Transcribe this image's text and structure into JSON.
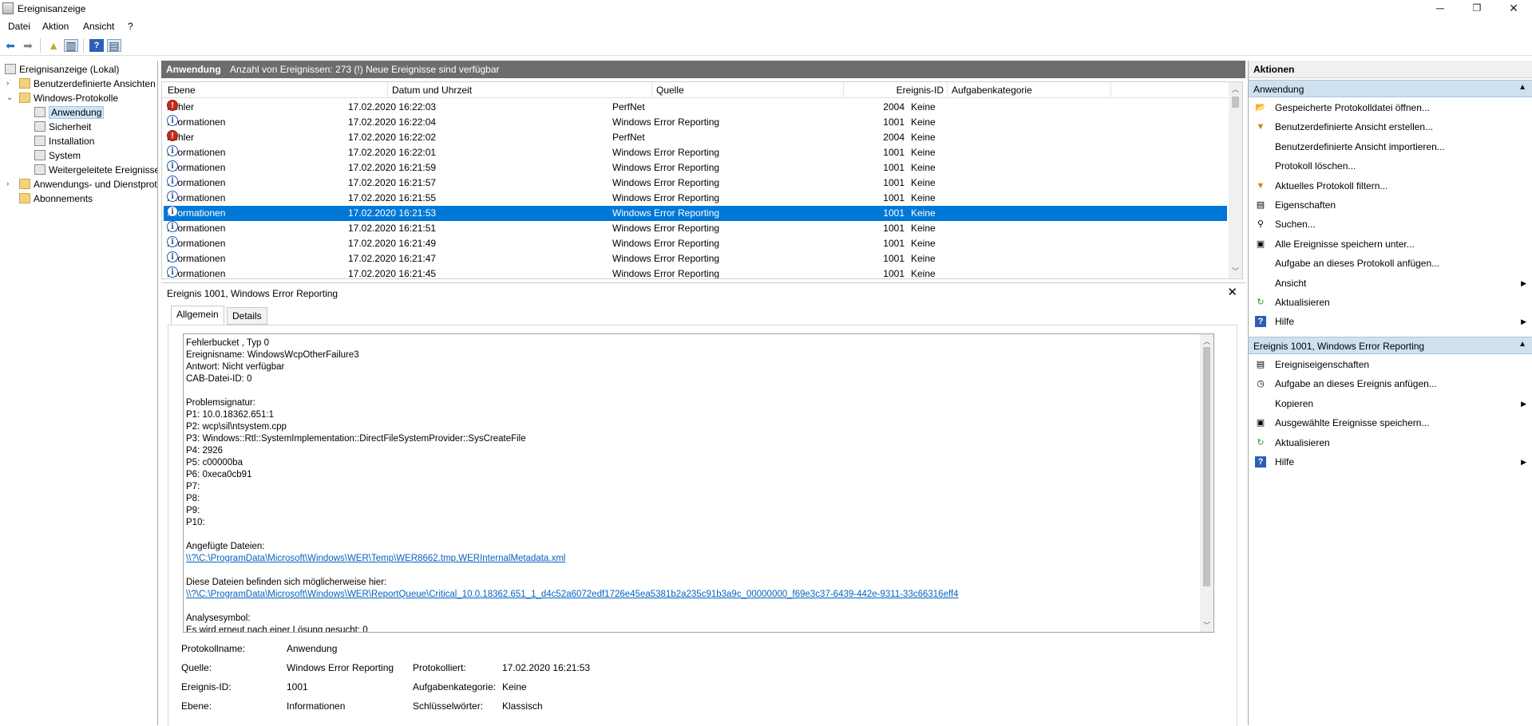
{
  "window": {
    "title": "Ereignisanzeige",
    "min": "─",
    "max": "❐",
    "close": "✕"
  },
  "menu": [
    "Datei",
    "Aktion",
    "Ansicht",
    "?"
  ],
  "tree": {
    "root": "Ereignisanzeige (Lokal)",
    "custom_views": "Benutzerdefinierte Ansichten",
    "windows_logs": "Windows-Protokolle",
    "logs": [
      "Anwendung",
      "Sicherheit",
      "Installation",
      "System",
      "Weitergeleitete Ereignisse"
    ],
    "app_services": "Anwendungs- und Dienstprotokolle",
    "subscriptions": "Abonnements"
  },
  "center": {
    "header_title": "Anwendung",
    "header_count": "Anzahl von Ereignissen: 273 (!) Neue Ereignisse sind verfügbar",
    "columns": [
      "Ebene",
      "Datum und Uhrzeit",
      "Quelle",
      "Ereignis-ID",
      "Aufgabenkategorie"
    ],
    "rows": [
      {
        "level": "Fehler",
        "icon": "error",
        "date": "17.02.2020 16:22:03",
        "source": "PerfNet",
        "id": "2004",
        "cat": "Keine"
      },
      {
        "level": "Informationen",
        "icon": "info",
        "date": "17.02.2020 16:22:04",
        "source": "Windows Error Reporting",
        "id": "1001",
        "cat": "Keine"
      },
      {
        "level": "Fehler",
        "icon": "error",
        "date": "17.02.2020 16:22:02",
        "source": "PerfNet",
        "id": "2004",
        "cat": "Keine"
      },
      {
        "level": "Informationen",
        "icon": "info",
        "date": "17.02.2020 16:22:01",
        "source": "Windows Error Reporting",
        "id": "1001",
        "cat": "Keine"
      },
      {
        "level": "Informationen",
        "icon": "info",
        "date": "17.02.2020 16:21:59",
        "source": "Windows Error Reporting",
        "id": "1001",
        "cat": "Keine"
      },
      {
        "level": "Informationen",
        "icon": "info",
        "date": "17.02.2020 16:21:57",
        "source": "Windows Error Reporting",
        "id": "1001",
        "cat": "Keine"
      },
      {
        "level": "Informationen",
        "icon": "info",
        "date": "17.02.2020 16:21:55",
        "source": "Windows Error Reporting",
        "id": "1001",
        "cat": "Keine"
      },
      {
        "level": "Informationen",
        "icon": "info",
        "date": "17.02.2020 16:21:53",
        "source": "Windows Error Reporting",
        "id": "1001",
        "cat": "Keine",
        "selected": true
      },
      {
        "level": "Informationen",
        "icon": "info",
        "date": "17.02.2020 16:21:51",
        "source": "Windows Error Reporting",
        "id": "1001",
        "cat": "Keine"
      },
      {
        "level": "Informationen",
        "icon": "info",
        "date": "17.02.2020 16:21:49",
        "source": "Windows Error Reporting",
        "id": "1001",
        "cat": "Keine"
      },
      {
        "level": "Informationen",
        "icon": "info",
        "date": "17.02.2020 16:21:47",
        "source": "Windows Error Reporting",
        "id": "1001",
        "cat": "Keine"
      },
      {
        "level": "Informationen",
        "icon": "info",
        "date": "17.02.2020 16:21:45",
        "source": "Windows Error Reporting",
        "id": "1001",
        "cat": "Keine"
      }
    ]
  },
  "detail": {
    "title": "Ereignis 1001, Windows Error Reporting",
    "tabs": [
      "Allgemein",
      "Details"
    ],
    "message_lines": [
      "Fehlerbucket , Typ 0",
      "Ereignisname: WindowsWcpOtherFailure3",
      "Antwort: Nicht verfügbar",
      "CAB-Datei-ID: 0",
      "",
      "Problemsignatur:",
      "P1: 10.0.18362.651:1",
      "P2: wcp\\sil\\ntsystem.cpp",
      "P3: Windows::Rtl::SystemImplementation::DirectFileSystemProvider::SysCreateFile",
      "P4: 2926",
      "P5: c00000ba",
      "P6: 0xeca0cb91",
      "P7:",
      "P8:",
      "P9:",
      "P10:",
      "",
      "Angefügte Dateien:"
    ],
    "link1": "\\\\?\\C:\\ProgramData\\Microsoft\\Windows\\WER\\Temp\\WER8662.tmp.WERInternalMetadata.xml",
    "located_label": "Diese Dateien befinden sich möglicherweise hier:",
    "link2": "\\\\?\\C:\\ProgramData\\Microsoft\\Windows\\WER\\ReportQueue\\Critical_10.0.18362.651_1_d4c52a6072edf1726e45ea5381b2a235c91b3a9c_00000000_f69e3c37-6439-442e-9311-33c66316eff4",
    "analysis_label": "Analysesymbol:",
    "analysis_cut": "Es wird erneut nach einer Lösung gesucht: 0",
    "props": {
      "logname_label": "Protokollname:",
      "logname": "Anwendung",
      "source_label": "Quelle:",
      "source": "Windows Error Reporting",
      "logged_label": "Protokolliert:",
      "logged": "17.02.2020 16:21:53",
      "eventid_label": "Ereignis-ID:",
      "eventid": "1001",
      "taskcat_label": "Aufgabenkategorie:",
      "taskcat": "Keine",
      "level_label": "Ebene:",
      "level": "Informationen",
      "keywords_label": "Schlüsselwörter:",
      "keywords": "Klassisch"
    }
  },
  "actions": {
    "header": "Aktionen",
    "section1": "Anwendung",
    "items1": [
      {
        "label": "Gespeicherte Protokolldatei öffnen...",
        "icon": "open-log-icon",
        "glyph": "📂"
      },
      {
        "label": "Benutzerdefinierte Ansicht erstellen...",
        "icon": "filter-icon",
        "glyph": "▼"
      },
      {
        "label": "Benutzerdefinierte Ansicht importieren...",
        "icon": "",
        "glyph": ""
      },
      {
        "label": "Protokoll löschen...",
        "icon": "",
        "glyph": ""
      },
      {
        "label": "Aktuelles Protokoll filtern...",
        "icon": "filter-icon",
        "glyph": "▼"
      },
      {
        "label": "Eigenschaften",
        "icon": "properties-icon",
        "glyph": "▤"
      },
      {
        "label": "Suchen...",
        "icon": "binoculars-icon",
        "glyph": "⚲"
      },
      {
        "label": "Alle Ereignisse speichern unter...",
        "icon": "save-icon",
        "glyph": "▣"
      },
      {
        "label": "Aufgabe an dieses Protokoll anfügen...",
        "icon": "",
        "glyph": ""
      },
      {
        "label": "Ansicht",
        "icon": "",
        "glyph": "",
        "submenu": true
      },
      {
        "label": "Aktualisieren",
        "icon": "refresh-icon",
        "glyph": "↻"
      },
      {
        "label": "Hilfe",
        "icon": "help-icon",
        "glyph": "?",
        "submenu": true
      }
    ],
    "section2": "Ereignis 1001, Windows Error Reporting",
    "items2": [
      {
        "label": "Ereigniseigenschaften",
        "icon": "event-properties-icon",
        "glyph": "▤"
      },
      {
        "label": "Aufgabe an dieses Ereignis anfügen...",
        "icon": "task-icon",
        "glyph": "◷"
      },
      {
        "label": "Kopieren",
        "icon": "",
        "glyph": "",
        "submenu": true
      },
      {
        "label": "Ausgewählte Ereignisse speichern...",
        "icon": "save-icon",
        "glyph": "▣"
      },
      {
        "label": "Aktualisieren",
        "icon": "refresh-icon",
        "glyph": "↻"
      },
      {
        "label": "Hilfe",
        "icon": "help-icon",
        "glyph": "?",
        "submenu": true
      }
    ]
  }
}
